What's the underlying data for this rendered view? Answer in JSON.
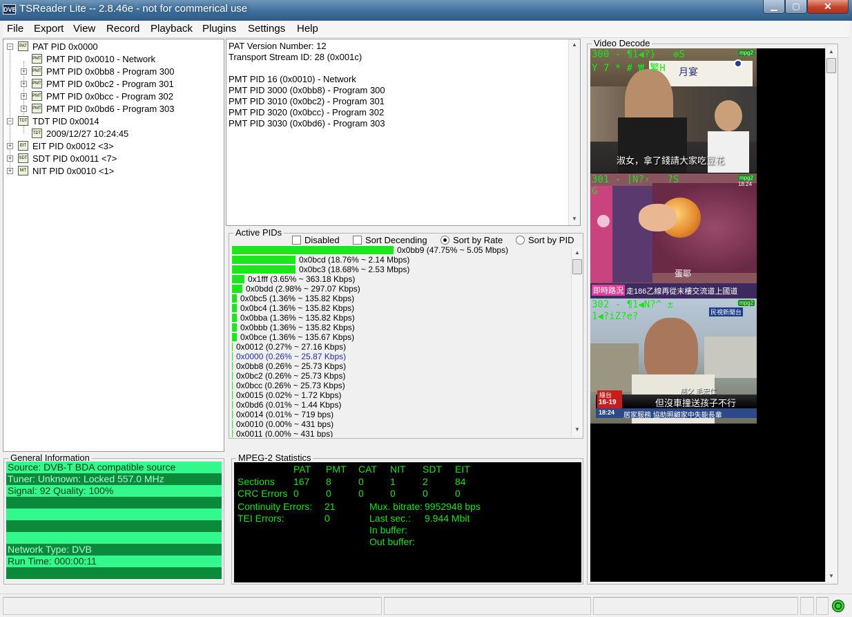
{
  "window": {
    "title": "TSReader Lite -- 2.8.46e - not for commerical use",
    "logo": "DVB"
  },
  "menu": [
    "File",
    "Export",
    "View",
    "Record",
    "Playback",
    "Plugins",
    "Settings",
    "Help"
  ],
  "tree": {
    "pat": "PAT PID 0x0000",
    "pmt": [
      "PMT PID 0x0010 - Network",
      "PMT PID 0x0bb8 - Program 300",
      "PMT PID 0x0bc2 - Program 301",
      "PMT PID 0x0bcc - Program 302",
      "PMT PID 0x0bd6 - Program 303"
    ],
    "tdt": "TDT PID 0x0014",
    "tdt_time": "2009/12/27 10:24:45",
    "eit": "EIT PID 0x0012 <3>",
    "sdt": "SDT PID 0x0011 <7>",
    "nit": "NIT PID 0x0010 <1>",
    "icons": {
      "pat": "PAT",
      "pmt": "PMT",
      "tdt": "TDT",
      "eit": "EIT",
      "sdt": "SDT",
      "nit": "NIT"
    }
  },
  "pat_info": [
    "PAT Version Number: 12",
    "Transport Stream ID: 28 (0x001c)",
    "",
    "PMT PID 16 (0x0010) - Network",
    "PMT PID 3000 (0x0bb8) - Program 300",
    "PMT PID 3010 (0x0bc2) - Program 301",
    "PMT PID 3020 (0x0bcc) - Program 302",
    "PMT PID 3030 (0x0bd6) - Program 303"
  ],
  "active_pids": {
    "title": "Active PIDs",
    "options": {
      "disabled": "Disabled",
      "sort_desc": "Sort Decending",
      "sort_rate": "Sort by Rate",
      "sort_pid": "Sort by PID",
      "selected": "sort_rate"
    },
    "bar_color": "#1ee61e",
    "rows": [
      {
        "pct": 47.75,
        "label": "0x0bb9 (47.75% ~ 5.05 Mbps)"
      },
      {
        "pct": 18.76,
        "label": "0x0bcd (18.76% ~ 2.14 Mbps)"
      },
      {
        "pct": 18.68,
        "label": "0x0bc3 (18.68% ~ 2.53 Mbps)"
      },
      {
        "pct": 3.65,
        "label": "0x1fff (3.65% ~ 363.18 Kbps)"
      },
      {
        "pct": 2.98,
        "label": "0x0bdd (2.98% ~ 297.07 Kbps)"
      },
      {
        "pct": 1.36,
        "label": "0x0bc5 (1.36% ~ 135.82 Kbps)"
      },
      {
        "pct": 1.36,
        "label": "0x0bc4 (1.36% ~ 135.82 Kbps)"
      },
      {
        "pct": 1.36,
        "label": "0x0bba (1.36% ~ 135.82 Kbps)"
      },
      {
        "pct": 1.36,
        "label": "0x0bbb (1.36% ~ 135.82 Kbps)"
      },
      {
        "pct": 1.36,
        "label": "0x0bce (1.36% ~ 135.67 Kbps)"
      },
      {
        "pct": 0.27,
        "label": "0x0012 (0.27% ~ 27.16 Kbps)"
      },
      {
        "pct": 0.26,
        "label": "0x0000 (0.26% ~ 25.87 Kbps)",
        "highlight": true
      },
      {
        "pct": 0.26,
        "label": "0x0bb8 (0.26% ~ 25.73 Kbps)"
      },
      {
        "pct": 0.26,
        "label": "0x0bc2 (0.26% ~ 25.73 Kbps)"
      },
      {
        "pct": 0.26,
        "label": "0x0bcc (0.26% ~ 25.73 Kbps)"
      },
      {
        "pct": 0.02,
        "label": "0x0015 (0.02% ~ 1.72 Kbps)"
      },
      {
        "pct": 0.01,
        "label": "0x0bd6 (0.01% ~ 1.44 Kbps)"
      },
      {
        "pct": 0.01,
        "label": "0x0014 (0.01% ~ 719 bps)"
      },
      {
        "pct": 0.0,
        "label": "0x0010 (0.00% ~ 431 bps)"
      },
      {
        "pct": 0.0,
        "label": "0x0011 (0.00% ~ 431 bps)"
      }
    ]
  },
  "general_info": {
    "title": "General Information",
    "rows": [
      "Source: DVB-T BDA compatible source",
      "Tuner: Unknown: Locked 557.0 MHz",
      "Signal: 92 Quality: 100%",
      "",
      "",
      "",
      "",
      "Network Type: DVB",
      "Run Time: 000:00:11",
      ""
    ],
    "color_light": "#33f88b",
    "color_dark": "#0b8a3c"
  },
  "mpeg": {
    "title": "MPEG-2 Statistics",
    "headers": [
      "PAT",
      "PMT",
      "CAT",
      "NIT",
      "SDT",
      "EIT"
    ],
    "sections_label": "Sections",
    "sections": [
      "167",
      "8",
      "0",
      "1",
      "2",
      "84"
    ],
    "crc_label": "CRC Errors",
    "crc": [
      "0",
      "0",
      "0",
      "0",
      "0",
      "0"
    ],
    "cc_label": "Continuity Errors:",
    "cc_value": "21",
    "tei_label": "TEI Errors:",
    "tei_value": "0",
    "mux_label": "Mux. bitrate:",
    "mux_value": "9952948 bps",
    "last_label": "Last sec.:",
    "last_value": "9.944 Mbit",
    "inbuf_label": "In buffer:",
    "outbuf_label": "Out buffer:"
  },
  "video": {
    "title": "Video Decode",
    "tag": "mpg2",
    "frames": [
      {
        "osd1": "300 - ¶1◀?}   ⊕S",
        "osd2": "Y 7 * # ₩ 繁H",
        "sign": "月宴",
        "subtitle": "淑女，拿了錢請大家吃豆花"
      },
      {
        "osd1": "301 - |N?›   ?S",
        "osd2": "G",
        "time": "18:24",
        "caption": "蛋耶",
        "ticker_left": "即時路況",
        "ticker": "走186乙線再從末樓交流道上國道"
      },
      {
        "osd1": "302 - ¶1◀N?^ ±",
        "osd2": "1◀?iZ?e?",
        "logo": "民視新聞台",
        "name": "慈父 毛宏仁",
        "headline": "但沒車撞送孩子不行",
        "bar": "居家服務 協助照顧家中失能長輩",
        "date": "16-19",
        "time": "18:24",
        "logo_small": "綠台"
      }
    ]
  }
}
